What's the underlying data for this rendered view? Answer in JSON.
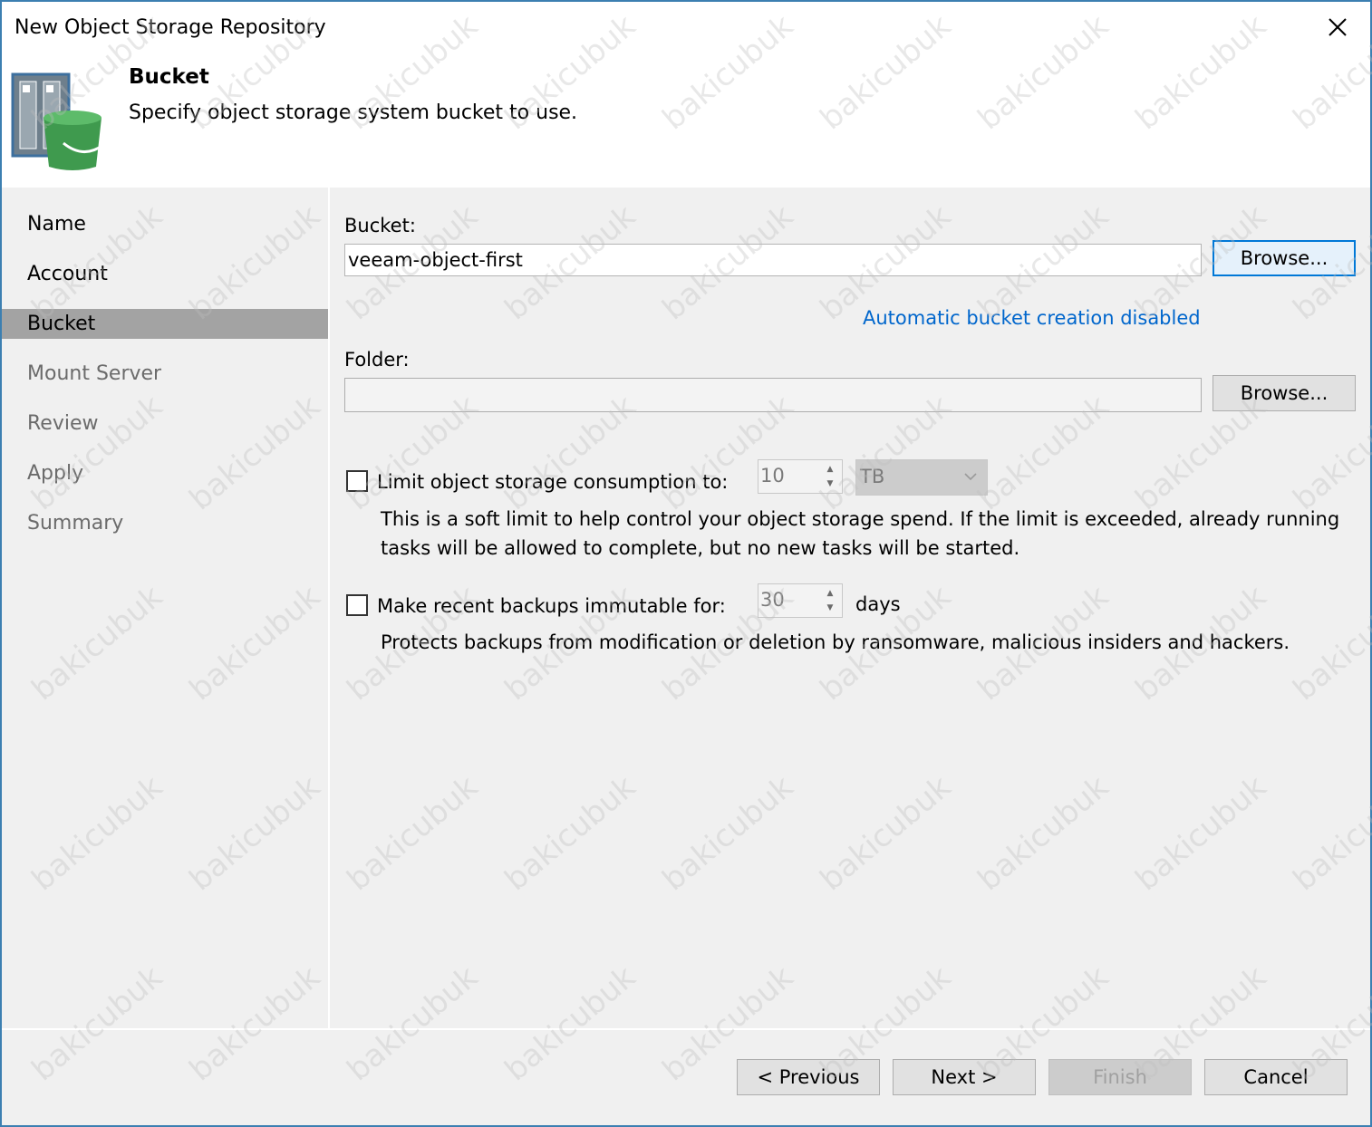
{
  "window": {
    "title": "New Object Storage Repository"
  },
  "header": {
    "title": "Bucket",
    "subtitle": "Specify object storage system bucket to use."
  },
  "sidebar": {
    "items": [
      {
        "label": "Name",
        "state": "done"
      },
      {
        "label": "Account",
        "state": "done"
      },
      {
        "label": "Bucket",
        "state": "active"
      },
      {
        "label": "Mount Server",
        "state": "pending"
      },
      {
        "label": "Review",
        "state": "pending"
      },
      {
        "label": "Apply",
        "state": "pending"
      },
      {
        "label": "Summary",
        "state": "pending"
      }
    ]
  },
  "bucket": {
    "label": "Bucket:",
    "value": "veeam-object-first",
    "browse_label": "Browse...",
    "auto_creation_link": "Automatic bucket creation disabled"
  },
  "folder": {
    "label": "Folder:",
    "value": "",
    "browse_label": "Browse..."
  },
  "limit": {
    "checked": false,
    "label": "Limit object storage consumption to:",
    "value": "10",
    "unit": "TB",
    "description_line1": "This is a soft limit to help control your object storage spend. If the limit is exceeded, already running",
    "description_line2": "tasks will be allowed to complete, but no new tasks will be started."
  },
  "immutable": {
    "checked": false,
    "label": "Make recent backups immutable for:",
    "value": "30",
    "unit": "days",
    "description": "Protects backups from modification or deletion by ransomware, malicious insiders and hackers."
  },
  "footer": {
    "previous_label": "< Previous",
    "next_label": "Next >",
    "finish_label": "Finish",
    "cancel_label": "Cancel"
  },
  "watermark": "bakicubuk",
  "colors": {
    "window_border": "#3c7fb1",
    "link": "#0066cc",
    "active_nav": "#a3a3a3"
  }
}
